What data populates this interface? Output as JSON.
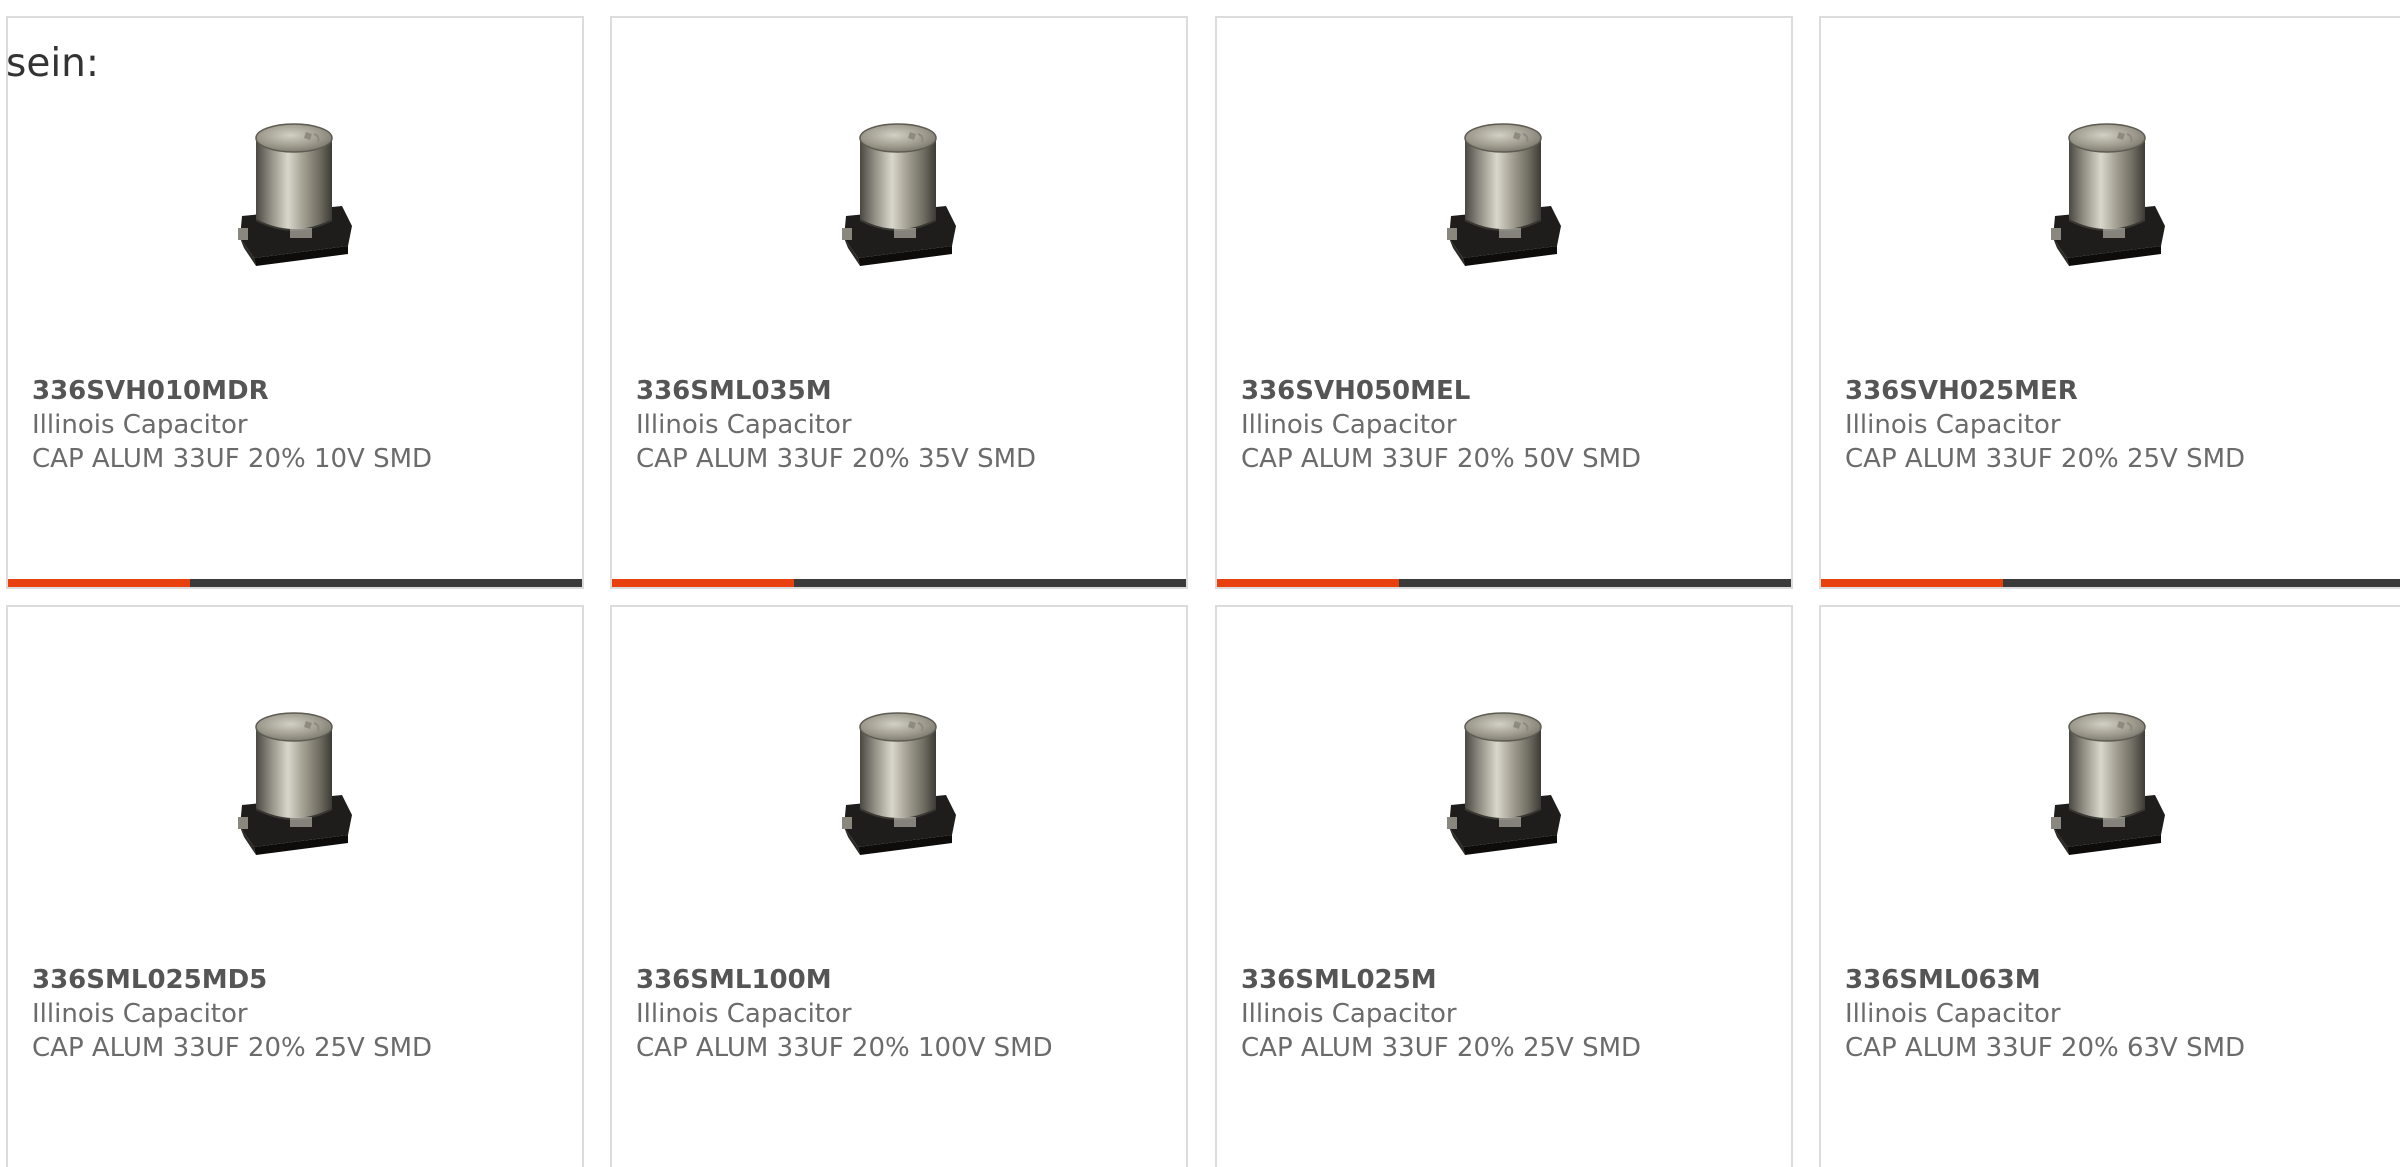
{
  "intro_text": "sein:",
  "colors": {
    "accent": "#e8400e",
    "bar": "#3a3a3a",
    "border": "#dcdcdc"
  },
  "products": [
    {
      "part_number": "336SVH010MDR",
      "manufacturer": "Illinois Capacitor",
      "description": "CAP ALUM 33UF 20% 10V SMD",
      "image_icon": "capacitor-image"
    },
    {
      "part_number": "336SML035M",
      "manufacturer": "Illinois Capacitor",
      "description": "CAP ALUM 33UF 20% 35V SMD",
      "image_icon": "capacitor-image"
    },
    {
      "part_number": "336SVH050MEL",
      "manufacturer": "Illinois Capacitor",
      "description": "CAP ALUM 33UF 20% 50V SMD",
      "image_icon": "capacitor-image"
    },
    {
      "part_number": "336SVH025MER",
      "manufacturer": "Illinois Capacitor",
      "description": "CAP ALUM 33UF 20% 25V SMD",
      "image_icon": "capacitor-image"
    },
    {
      "part_number": "336SML025MD5",
      "manufacturer": "Illinois Capacitor",
      "description": "CAP ALUM 33UF 20% 25V SMD",
      "image_icon": "capacitor-image"
    },
    {
      "part_number": "336SML100M",
      "manufacturer": "Illinois Capacitor",
      "description": "CAP ALUM 33UF 20% 100V SMD",
      "image_icon": "capacitor-image"
    },
    {
      "part_number": "336SML025M",
      "manufacturer": "Illinois Capacitor",
      "description": "CAP ALUM 33UF 20% 25V SMD",
      "image_icon": "capacitor-image"
    },
    {
      "part_number": "336SML063M",
      "manufacturer": "Illinois Capacitor",
      "description": "CAP ALUM 33UF 20% 63V SMD",
      "image_icon": "capacitor-image"
    }
  ]
}
